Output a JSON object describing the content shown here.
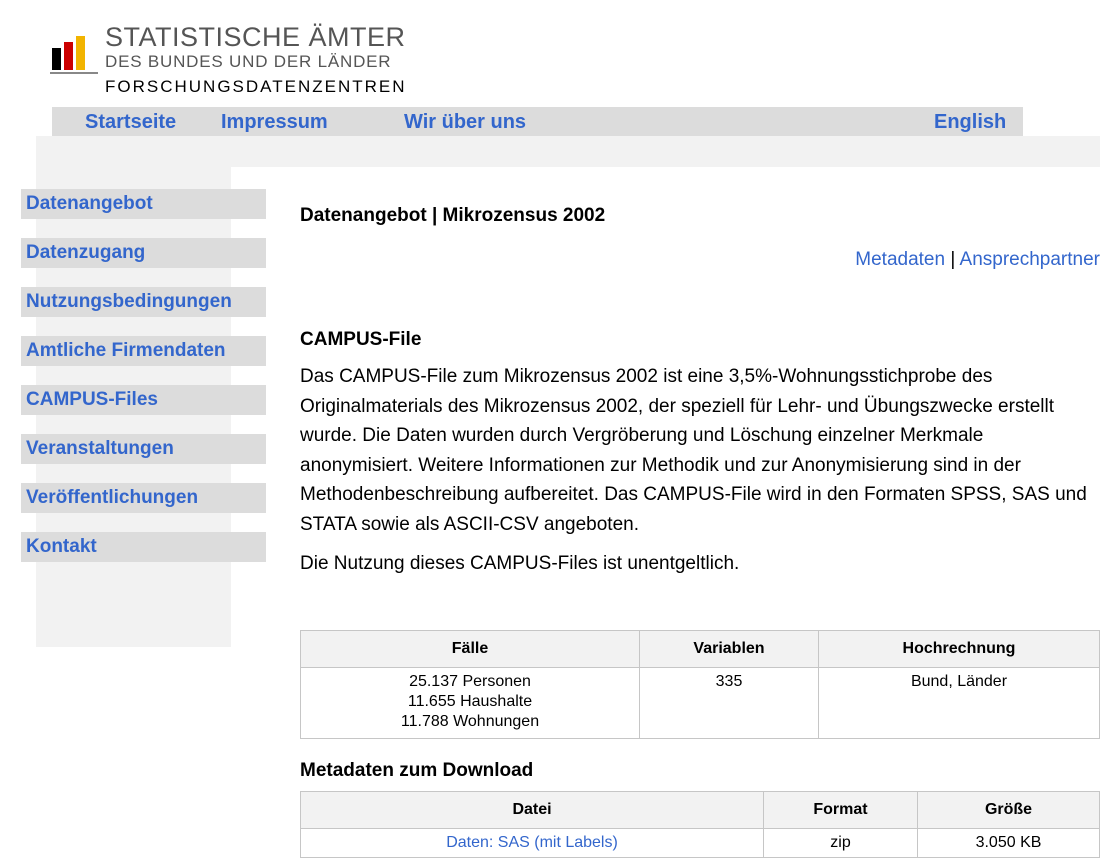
{
  "logo": {
    "line1": "STATISTISCHE ÄMTER",
    "line2": "DES BUNDES UND DER LÄNDER",
    "line3": "FORSCHUNGSDATENZENTREN",
    "bar_colors": [
      "#000000",
      "#cc0000",
      "#f2b400",
      "#888888"
    ]
  },
  "topnav": {
    "startseite": "Startseite",
    "impressum": "Impressum",
    "wir_ueber_uns": "Wir über uns",
    "english": "English"
  },
  "sidebar": {
    "items": [
      {
        "label": "Datenangebot"
      },
      {
        "label": "Datenzugang"
      },
      {
        "label": "Nutzungsbedingungen"
      },
      {
        "label": "Amtliche Firmendaten"
      },
      {
        "label": "CAMPUS-Files"
      },
      {
        "label": "Veranstaltungen"
      },
      {
        "label": "Veröffentlichungen"
      },
      {
        "label": "Kontakt"
      }
    ]
  },
  "main": {
    "page_title": "Datenangebot | Mikrozensus 2002",
    "links": {
      "metadaten": "Metadaten",
      "separator": "|",
      "ansprechpartner": "Ansprechpartner"
    },
    "section_title": "CAMPUS-File",
    "paragraph1": "Das CAMPUS-File zum Mikrozensus 2002 ist eine 3,5%-Wohnungsstichprobe des Originalmaterials des Mikrozensus 2002, der speziell für Lehr- und Übungszwecke erstellt wurde. Die Daten wurden durch Vergröberung und Löschung einzelner Merkmale anonymisiert. Weitere Informationen zur Methodik und zur Anonymisierung sind in der Methodenbeschreibung aufbereitet. Das CAMPUS-File wird in den Formaten SPSS, SAS und STATA sowie als ASCII-CSV angeboten.",
    "paragraph2": "Die Nutzung dieses CAMPUS-Files ist unentgeltlich.",
    "info_table": {
      "headers": [
        "Fälle",
        "Variablen",
        "Hochrechnung"
      ],
      "faelle": [
        "25.137 Personen",
        "11.655 Haushalte",
        "11.788 Wohnungen"
      ],
      "variablen": "335",
      "hochrechnung": "Bund, Länder"
    },
    "download_title": "Metadaten zum Download",
    "download_table": {
      "headers": [
        "Datei",
        "Format",
        "Größe"
      ],
      "rows": [
        {
          "datei": "Daten: SAS (mit Labels)",
          "format": "zip",
          "groesse": "3.050 KB"
        }
      ]
    }
  }
}
